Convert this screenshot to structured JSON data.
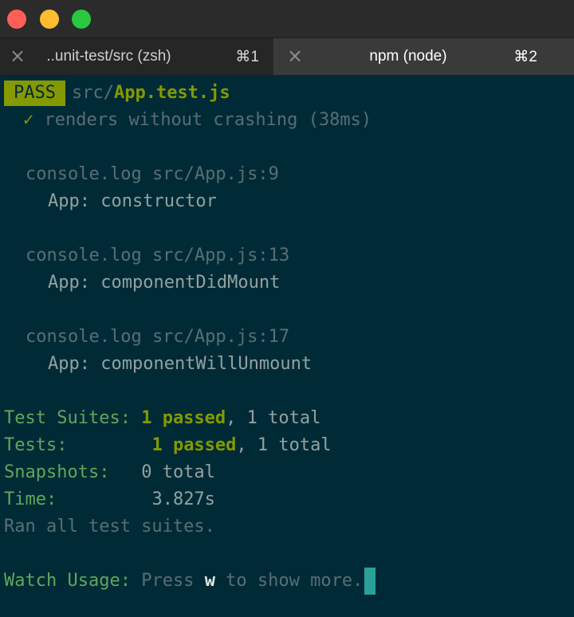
{
  "window": {
    "tabs": [
      {
        "title": "..unit-test/src (zsh)",
        "shortcut": "⌘1",
        "active": false
      },
      {
        "title": "npm (node)",
        "shortcut": "⌘2",
        "active": true
      }
    ]
  },
  "terminal": {
    "pass_badge": "PASS",
    "test_file_dir": "src/",
    "test_file_name": "App.test.js",
    "check_mark": "✓",
    "test_case": "renders without crashing (38ms)",
    "logs": [
      {
        "source": "console.log src/App.js:9",
        "message": "App: constructor"
      },
      {
        "source": "console.log src/App.js:13",
        "message": "App: componentDidMount"
      },
      {
        "source": "console.log src/App.js:17",
        "message": "App: componentWillUnmount"
      }
    ],
    "summary": {
      "suites_label": "Test Suites:",
      "suites_passed": "1 passed",
      "suites_total": ", 1 total",
      "tests_label": "Tests:",
      "tests_passed": "1 passed",
      "tests_total": ", 1 total",
      "snapshots_label": "Snapshots:",
      "snapshots_value": "0 total",
      "time_label": "Time:",
      "time_value": "3.827s",
      "ran_all": "Ran all test suites."
    },
    "watch": {
      "label": "Watch Usage:",
      "press": "Press ",
      "key": "w",
      "rest": " to show more."
    }
  },
  "colors": {
    "background": "#002b36",
    "pass_badge": "#859900",
    "cursor": "#2aa198",
    "close": "#ff5f57",
    "minimize": "#febc2e",
    "maximize": "#28c840"
  }
}
